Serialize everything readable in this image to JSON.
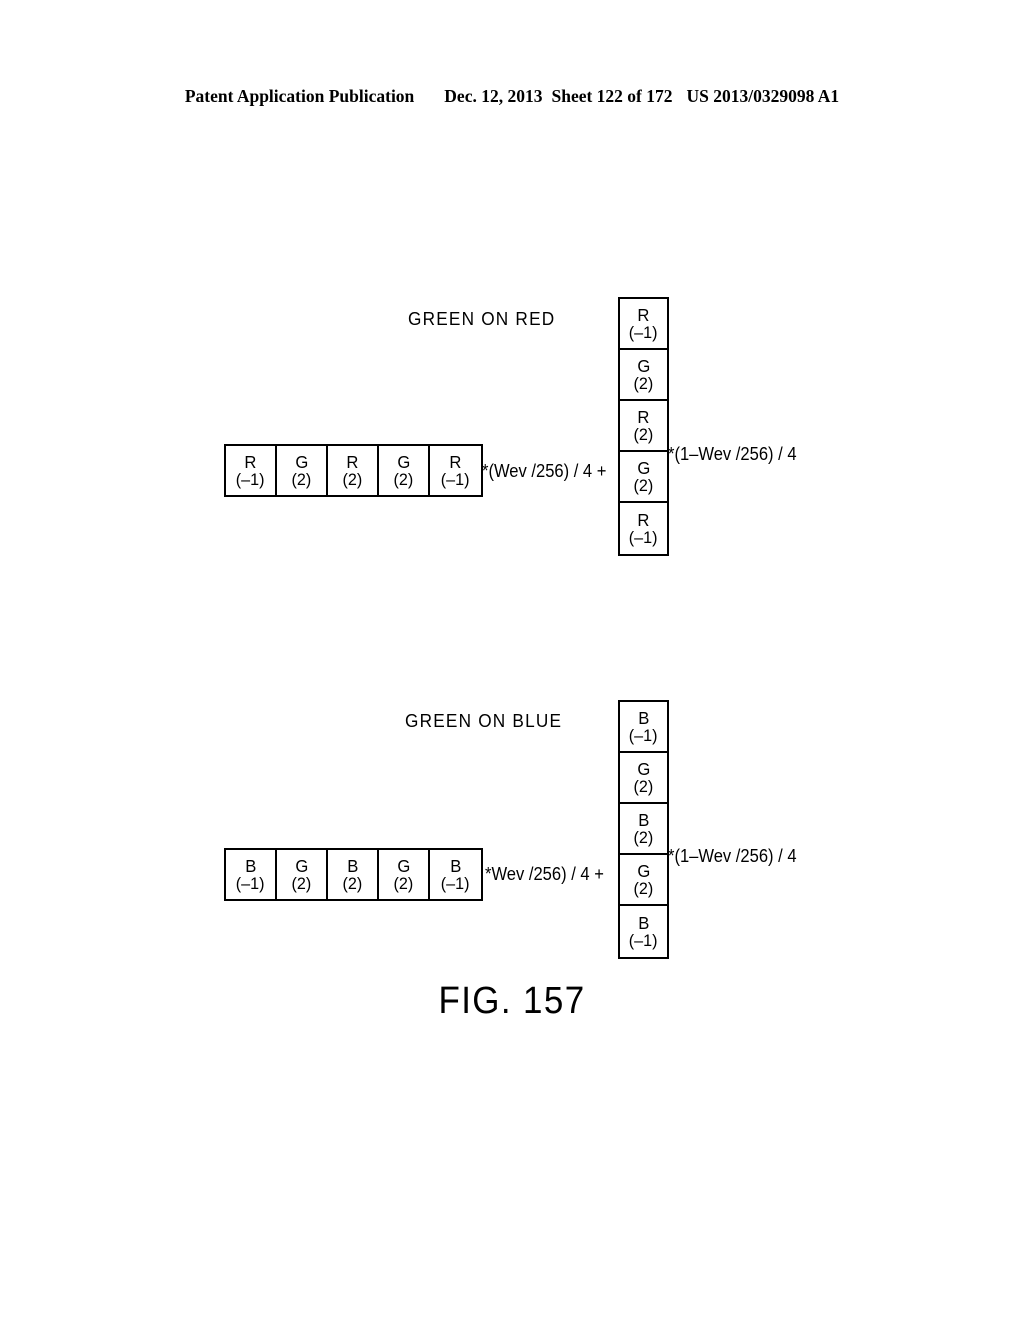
{
  "header": {
    "publication": "Patent Application Publication",
    "date": "Dec. 12, 2013",
    "sheet": "Sheet 122 of 172",
    "patent_number": "US 2013/0329098 A1"
  },
  "figure": {
    "caption": "FIG. 157",
    "groups": [
      {
        "label": "GREEN ON RED",
        "row": {
          "cells": [
            {
              "channel": "R",
              "value": "(–1)"
            },
            {
              "channel": "G",
              "value": "(2)"
            },
            {
              "channel": "R",
              "value": "(2)"
            },
            {
              "channel": "G",
              "value": "(2)"
            },
            {
              "channel": "R",
              "value": "(–1)"
            }
          ],
          "formula": "*(Wev /256) / 4 +"
        },
        "column": {
          "cells": [
            {
              "channel": "R",
              "value": "(–1)"
            },
            {
              "channel": "G",
              "value": "(2)"
            },
            {
              "channel": "R",
              "value": "(2)"
            },
            {
              "channel": "G",
              "value": "(2)"
            },
            {
              "channel": "R",
              "value": "(–1)"
            }
          ],
          "formula": "*(1–Wev /256) / 4"
        }
      },
      {
        "label": "GREEN ON BLUE",
        "row": {
          "cells": [
            {
              "channel": "B",
              "value": "(–1)"
            },
            {
              "channel": "G",
              "value": "(2)"
            },
            {
              "channel": "B",
              "value": "(2)"
            },
            {
              "channel": "G",
              "value": "(2)"
            },
            {
              "channel": "B",
              "value": "(–1)"
            }
          ],
          "formula": "*Wev /256) / 4 +"
        },
        "column": {
          "cells": [
            {
              "channel": "B",
              "value": "(–1)"
            },
            {
              "channel": "G",
              "value": "(2)"
            },
            {
              "channel": "B",
              "value": "(2)"
            },
            {
              "channel": "G",
              "value": "(2)"
            },
            {
              "channel": "B",
              "value": "(–1)"
            }
          ],
          "formula": "*(1–Wev /256) / 4"
        }
      }
    ]
  }
}
